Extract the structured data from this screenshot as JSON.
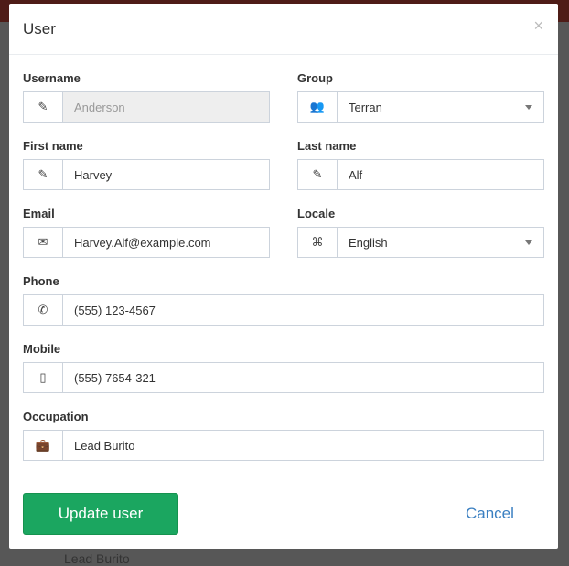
{
  "background": {
    "fragment": "Lead Burito"
  },
  "modal": {
    "title": "User",
    "close": "×"
  },
  "fields": {
    "username": {
      "label": "Username",
      "value": "Anderson",
      "icon": "edit-icon"
    },
    "group": {
      "label": "Group",
      "value": "Terran",
      "icon": "users-icon"
    },
    "first_name": {
      "label": "First name",
      "value": "Harvey",
      "icon": "edit-icon"
    },
    "last_name": {
      "label": "Last name",
      "value": "Alf",
      "icon": "edit-icon"
    },
    "email": {
      "label": "Email",
      "value": "Harvey.Alf@example.com",
      "icon": "envelope-icon"
    },
    "locale": {
      "label": "Locale",
      "value": "English",
      "icon": "language-icon"
    },
    "phone": {
      "label": "Phone",
      "value": "(555) 123-4567",
      "icon": "phone-icon"
    },
    "mobile": {
      "label": "Mobile",
      "value": "(555) 7654-321",
      "icon": "mobile-icon"
    },
    "occupation": {
      "label": "Occupation",
      "value": "Lead Burito",
      "icon": "briefcase-icon"
    }
  },
  "footer": {
    "submit": "Update user",
    "cancel": "Cancel"
  }
}
